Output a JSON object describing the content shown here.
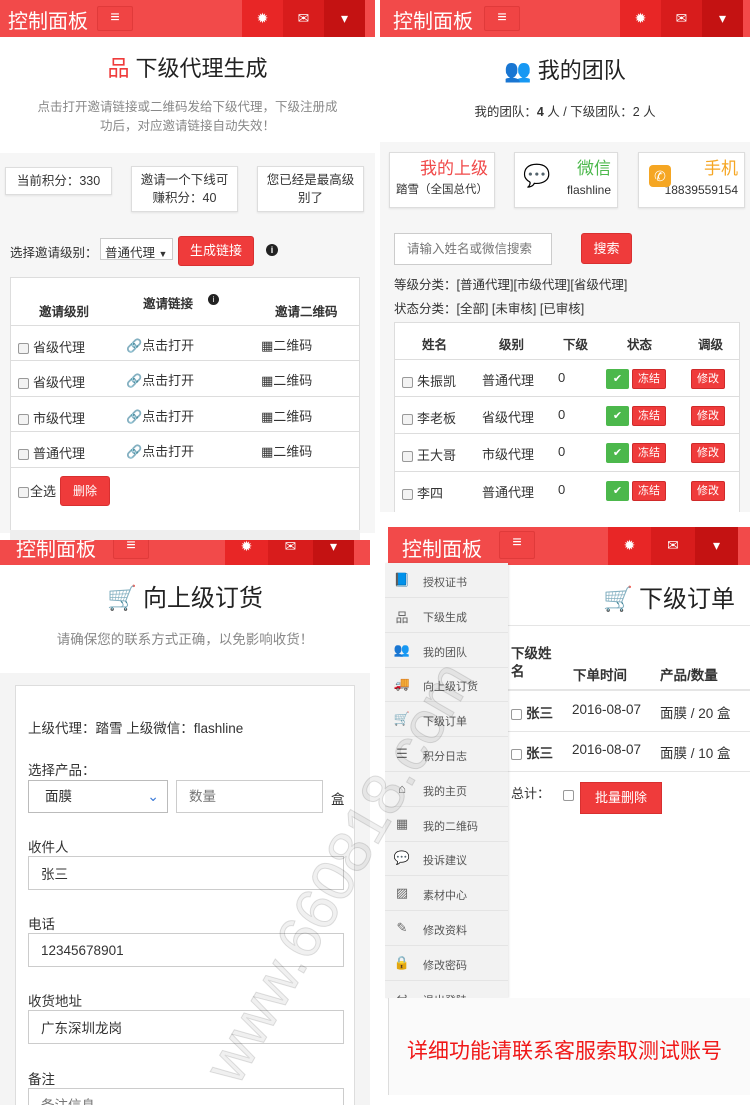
{
  "common": {
    "header_title": "控制面板",
    "menu": "≡",
    "gear": "✹",
    "mail": "✉",
    "caret": "▾"
  },
  "p1": {
    "title": "下级代理生成",
    "subtitle1": "点击打开邀请链接或二维码发给下级代理，下级注册成",
    "subtitle2": "功后，对应邀请链接自动失效！",
    "points": "当前积分：330",
    "earn1": "邀请一个下线可",
    "earn2": "赚积分：40",
    "top1": "您已经是最高级",
    "top2": "别了",
    "select_label": "选择邀请级别：",
    "select_value": "普通代理",
    "generate": "生成链接",
    "cols": [
      "邀请级别",
      "邀请链接",
      "邀请二维码"
    ],
    "rows": [
      {
        "level": "省级代理",
        "link": "🔗点击打开",
        "qr": "▦二维码"
      },
      {
        "level": "省级代理",
        "link": "🔗点击打开",
        "qr": "▦二维码"
      },
      {
        "level": "市级代理",
        "link": "🔗点击打开",
        "qr": "▦二维码"
      },
      {
        "level": "普通代理",
        "link": "🔗点击打开",
        "qr": "▦二维码"
      }
    ],
    "select_all": "全选",
    "delete": "删除"
  },
  "p2": {
    "title": "我的团队",
    "summary_a": "我的团队：",
    "team": "4",
    "summary_b": " 人 / 下级团队：",
    "sub": "2",
    "summary_c": " 人",
    "cards": [
      {
        "title": "我的上级",
        "value": "踏雪（全国总代）",
        "color": "#f04848"
      },
      {
        "title": "微信",
        "value": "flashline",
        "color": "#4cb84c"
      },
      {
        "title": "手机",
        "value": "18839559154",
        "color": "#f5a623"
      }
    ],
    "search_placeholder": "请输入姓名或微信搜索",
    "search": "搜索",
    "level_filter": "等级分类：[普通代理][市级代理][省级代理]",
    "status_filter": "状态分类：[全部]  [未审核]  [已审核]",
    "cols": [
      "姓名",
      "级别",
      "下级",
      "状态",
      "调级"
    ],
    "rows": [
      {
        "name": "朱振凯",
        "level": "普通代理",
        "sub": "0"
      },
      {
        "name": "李老板",
        "level": "省级代理",
        "sub": "0"
      },
      {
        "name": "王大哥",
        "level": "市级代理",
        "sub": "0"
      },
      {
        "name": "李四",
        "level": "普通代理",
        "sub": "0"
      }
    ],
    "freeze": "冻结",
    "edit": "修改"
  },
  "p3": {
    "title": "向上级订货",
    "subtitle": "请确保您的联系方式正确，以免影响收货！",
    "info": "上级代理：踏雪  上级微信：flashline",
    "product_label": "选择产品：",
    "product": "面膜",
    "qty_placeholder": "数量",
    "unit": "盒",
    "recipient_label": "收件人",
    "recipient": "张三",
    "phone_label": "电话",
    "phone": "12345678901",
    "address_label": "收货地址",
    "address": "广东深圳龙岗",
    "note_label": "备注",
    "note_placeholder": "备注信息"
  },
  "p4": {
    "menu": [
      {
        "icon": "📘",
        "label": "授权证书"
      },
      {
        "icon": "品",
        "label": "下级生成"
      },
      {
        "icon": "👥",
        "label": "我的团队"
      },
      {
        "icon": "🚚",
        "label": "向上级订货"
      },
      {
        "icon": "🛒",
        "label": "下级订单"
      },
      {
        "icon": "☰",
        "label": "积分日志"
      },
      {
        "icon": "⌂",
        "label": "我的主页"
      },
      {
        "icon": "▦",
        "label": "我的二维码"
      },
      {
        "icon": "💬",
        "label": "投诉建议"
      },
      {
        "icon": "▨",
        "label": "素材中心"
      },
      {
        "icon": "✎",
        "label": "修改资料"
      },
      {
        "icon": "🔒",
        "label": "修改密码"
      },
      {
        "icon": "↩",
        "label": "退出登陆"
      }
    ],
    "title": "下级订单",
    "col_name1": "下级姓",
    "col_name2": "名",
    "col_time": "下单时间",
    "col_product": "产品/数量",
    "rows": [
      {
        "name": "张三",
        "time": "2016-08-07",
        "product": "面膜 / 20 盒"
      },
      {
        "name": "张三",
        "time": "2016-08-07",
        "product": "面膜 / 10 盒"
      }
    ],
    "total": "总计：",
    "batch_delete": "批量删除"
  },
  "notice": "详细功能请联系客服索取测试账号",
  "watermark": "www.660818.com"
}
